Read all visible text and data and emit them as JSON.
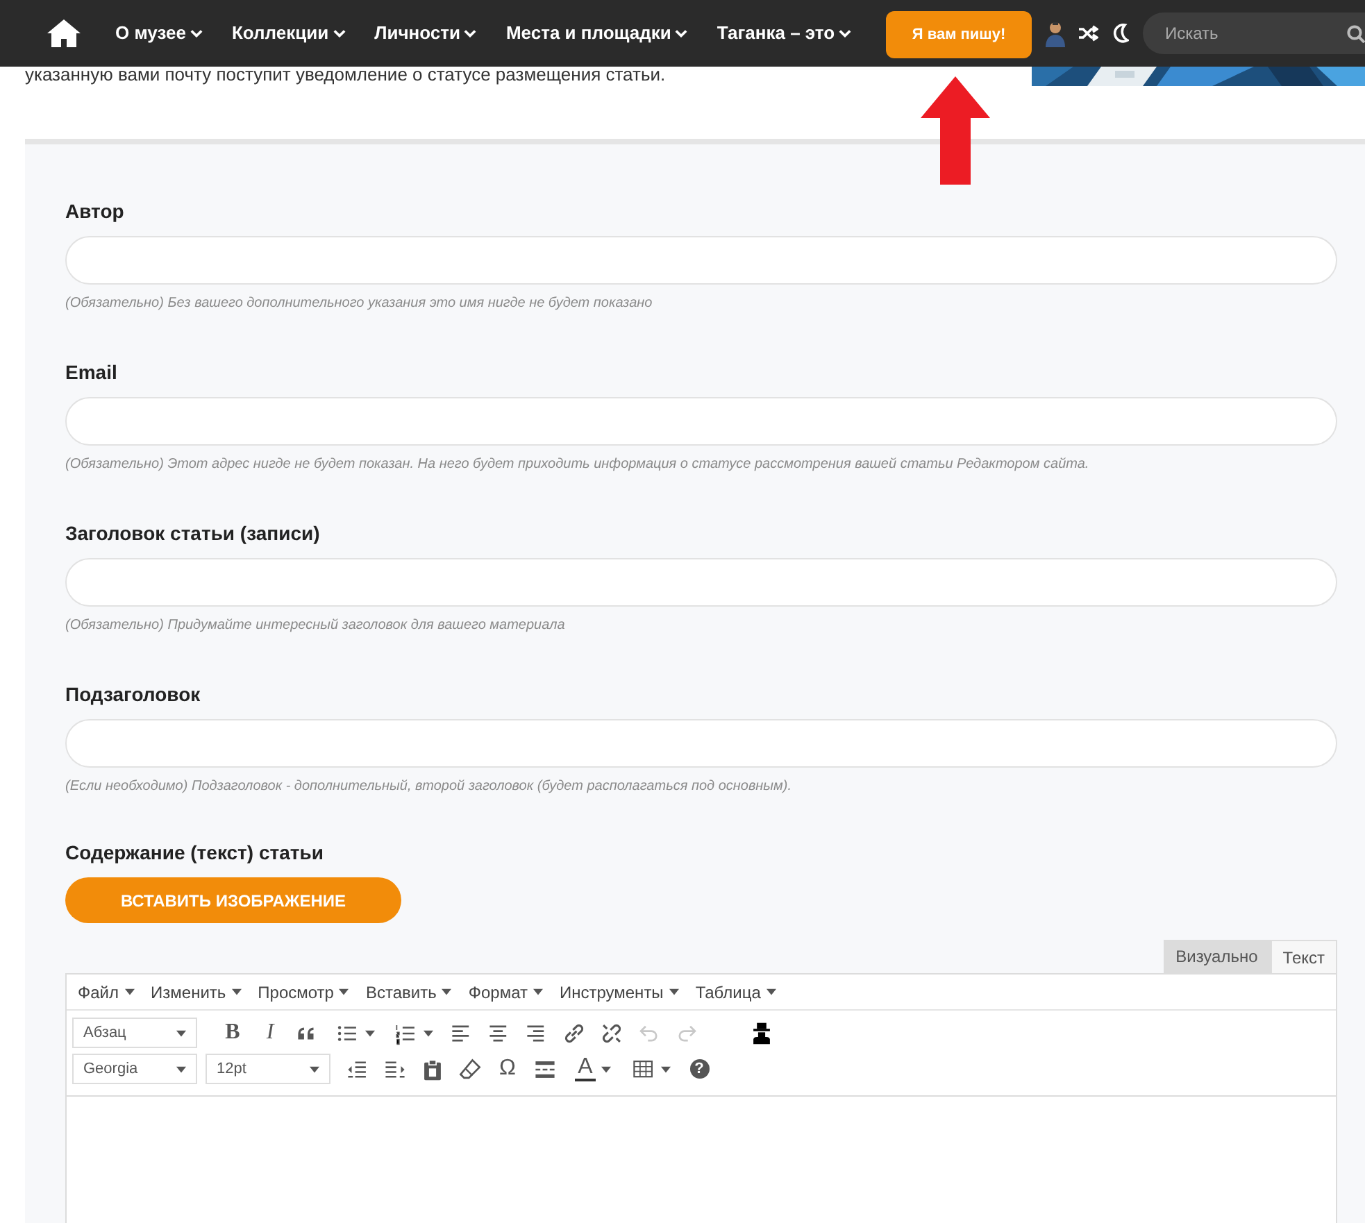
{
  "nav": {
    "items": [
      {
        "label": "О музее"
      },
      {
        "label": "Коллекции"
      },
      {
        "label": "Личности"
      },
      {
        "label": "Места и площадки"
      },
      {
        "label": "Таганка – это"
      }
    ],
    "cta": "Я вам пишу!",
    "search": {
      "placeholder": "Искать"
    }
  },
  "intro": "указанную вами почту поступит уведомление о статусе размещения статьи.",
  "fields": [
    {
      "label": "Автор",
      "hint": "(Обязательно) Без вашего дополнительного указания это имя нигде не будет показано"
    },
    {
      "label": "Email",
      "hint": "(Обязательно) Этот адрес нигде не будет показан. На него будет приходить информация о статусе рассмотрения вашей статьи Редактором сайта."
    },
    {
      "label": "Заголовок статьи (записи)",
      "hint": "(Обязательно) Придумайте интересный заголовок для вашего материала"
    },
    {
      "label": "Подзаголовок",
      "hint": "(Если необходимо) Подзаголовок - дополнительный, второй заголовок (будет располагаться под основным)."
    }
  ],
  "content": {
    "label": "Содержание (текст) статьи",
    "insert_button": "ВСТАВИТЬ ИЗОБРАЖЕНИЕ",
    "tabs": [
      {
        "label": "Визуально",
        "selected": true
      },
      {
        "label": "Текст",
        "selected": false
      }
    ],
    "menu": [
      "Файл",
      "Изменить",
      "Просмотр",
      "Вставить",
      "Формат",
      "Инструменты",
      "Таблица"
    ],
    "toolbar": [
      [
        {
          "kind": "select",
          "value": "Абзац",
          "disabled": false
        },
        {
          "kind": "bold",
          "text": "B",
          "disabled": false
        },
        {
          "kind": "italic",
          "text": "I",
          "disabled": false
        },
        {
          "kind": "quote",
          "disabled": false
        },
        {
          "kind": "bullet-list",
          "disabled": false
        },
        {
          "kind": "numbered-list",
          "disabled": false
        },
        {
          "kind": "align-left",
          "disabled": false
        },
        {
          "kind": "align-center",
          "disabled": false
        },
        {
          "kind": "align-right",
          "disabled": false
        },
        {
          "kind": "link",
          "disabled": false
        },
        {
          "kind": "unlink",
          "disabled": false
        },
        {
          "kind": "undo",
          "disabled": true
        },
        {
          "kind": "redo",
          "disabled": true
        },
        {
          "kind": "figure",
          "disabled": false
        }
      ],
      [
        {
          "kind": "select",
          "value": "Georgia",
          "disabled": false
        },
        {
          "kind": "select",
          "value": "12pt",
          "disabled": false
        },
        {
          "kind": "outdent",
          "disabled": false
        },
        {
          "kind": "indent",
          "disabled": false
        },
        {
          "kind": "paste",
          "disabled": false
        },
        {
          "kind": "eraser",
          "disabled": false
        },
        {
          "kind": "glyph",
          "text": "Ω",
          "disabled": false
        },
        {
          "kind": "rule",
          "disabled": false
        },
        {
          "kind": "text-color",
          "text": "A",
          "disabled": false
        },
        {
          "kind": "table",
          "disabled": false
        },
        {
          "kind": "help",
          "text": "?",
          "disabled": false
        }
      ]
    ]
  }
}
